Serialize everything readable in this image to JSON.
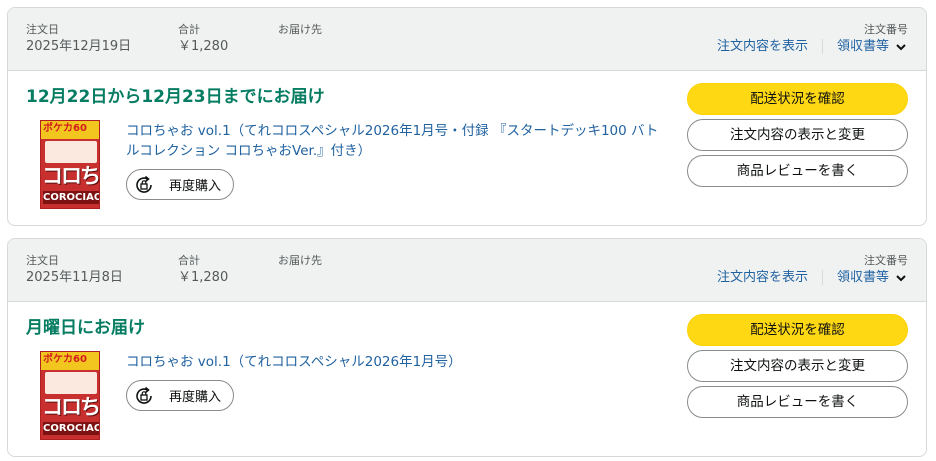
{
  "orders": [
    {
      "date_label": "注文日",
      "date": "2025年12月19日",
      "total_label": "合計",
      "total": "￥1,280",
      "ship_label": "お届け先",
      "order_num_label": "注文番号",
      "details_link": "注文内容を表示",
      "receipt_link": "領収書等",
      "delivery": "12月22日から12月23日までにお届け",
      "product_title": "コロちゃお vol.1（てれコロスペシャル2026年1月号・付録 『スタートデッキ100 バトルコレクション コロちゃおVer.』付き）",
      "buy_again": "再度購入",
      "track_button": "配送状況を確認",
      "view_edit_button": "注文内容の表示と変更",
      "review_button": "商品レビューを書く"
    },
    {
      "date_label": "注文日",
      "date": "2025年11月8日",
      "total_label": "合計",
      "total": "￥1,280",
      "ship_label": "お届け先",
      "order_num_label": "注文番号",
      "details_link": "注文内容を表示",
      "receipt_link": "領収書等",
      "delivery": "月曜日にお届け",
      "product_title": "コロちゃお vol.1（てれコロスペシャル2026年1月号）",
      "buy_again": "再度購入",
      "track_button": "配送状況を確認",
      "view_edit_button": "注文内容の表示と変更",
      "review_button": "商品レビューを書く"
    }
  ],
  "cover": {
    "top_text": "ポケカ60",
    "big_text": "コロちゃお",
    "bottom_text": "COROCIAO"
  },
  "icons": {
    "chevron": "chevron-down-icon",
    "rebuy": "rebuy-icon"
  },
  "colors": {
    "link": "#2162a1",
    "delivery": "#067d62",
    "primary_button": "#ffd814",
    "header_bg": "#f0f2f2"
  }
}
